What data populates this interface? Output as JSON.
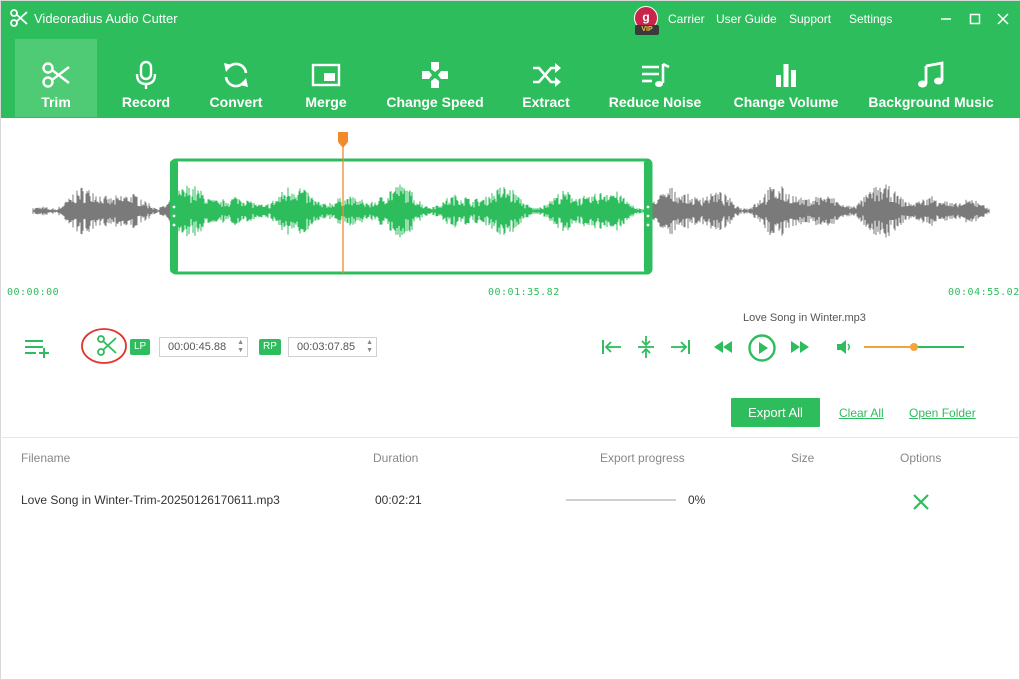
{
  "app": {
    "title": "Videoradius Audio Cutter",
    "vip_letter": "g",
    "vip_label": "VIP",
    "links": [
      "Carrier",
      "User Guide",
      "Support",
      "Settings"
    ],
    "accent": "#2ebd5c"
  },
  "toolbar": [
    {
      "label": "Trim",
      "icon": "scissors-icon",
      "active": true
    },
    {
      "label": "Record",
      "icon": "microphone-icon",
      "active": false
    },
    {
      "label": "Convert",
      "icon": "refresh-icon",
      "active": false
    },
    {
      "label": "Merge",
      "icon": "merge-icon",
      "active": false
    },
    {
      "label": "Change Speed",
      "icon": "gamepad-icon",
      "active": false
    },
    {
      "label": "Extract",
      "icon": "shuffle-icon",
      "active": false
    },
    {
      "label": "Reduce Noise",
      "icon": "music-list-icon",
      "active": false
    },
    {
      "label": "Change Volume",
      "icon": "bar-chart-icon",
      "active": false
    },
    {
      "label": "Background Music",
      "icon": "music-note-icon",
      "active": false
    }
  ],
  "timeline": {
    "start": "00:00:00",
    "middle": "00:01:35.82",
    "end": "00:04:55.02"
  },
  "controls": {
    "lp_label": "LP",
    "lp_value": "00:00:45.88",
    "rp_label": "RP",
    "rp_value": "00:03:07.85",
    "current_file": "Love Song in Winter.mp3",
    "volume_level": 0.5
  },
  "actions": {
    "export_all": "Export All",
    "clear_all": "Clear All",
    "open_folder": "Open Folder"
  },
  "table": {
    "headers": {
      "filename": "Filename",
      "duration": "Duration",
      "progress": "Export progress",
      "size": "Size",
      "options": "Options"
    },
    "rows": [
      {
        "filename": "Love Song in Winter-Trim-20250126170611.mp3",
        "duration": "00:02:21",
        "progress_text": "0%",
        "progress": 0,
        "size": ""
      }
    ]
  }
}
